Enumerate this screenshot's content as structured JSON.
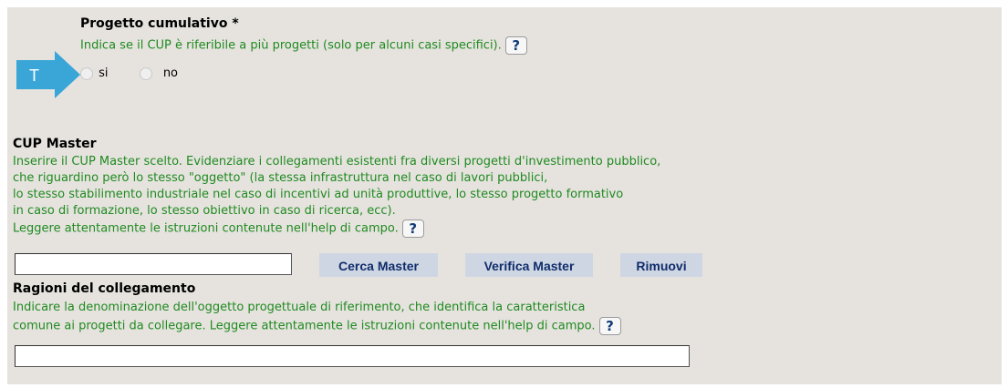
{
  "progetto": {
    "title": "Progetto cumulativo *",
    "description": "Indica se il CUP è riferibile a più progetti (solo per alcuni casi specifici).",
    "help_label": "?",
    "tag_label": "T",
    "options": [
      "si",
      "no"
    ]
  },
  "cup_master": {
    "title": "CUP Master",
    "lines": [
      "Inserire il CUP Master scelto. Evidenziare i collegamenti esistenti fra diversi progetti d'investimento pubblico,",
      "che riguardino però lo stesso \"oggetto\" (la stessa infrastruttura nel caso di lavori pubblici,",
      "lo stesso stabilimento industriale nel caso di incentivi ad unità produttive, lo stesso progetto formativo",
      "in caso di formazione, lo stesso obiettivo in caso di ricerca, ecc).",
      "Leggere attentamente le istruzioni contenute nell'help di campo."
    ],
    "help_label": "?",
    "input_value": "",
    "buttons": {
      "cerca": "Cerca Master",
      "verifica": "Verifica Master",
      "rimuovi": "Rimuovi"
    }
  },
  "ragioni": {
    "title": "Ragioni del collegamento",
    "lines": [
      "Indicare la denominazione dell'oggetto progettuale di riferimento, che identifica la caratteristica",
      "comune ai progetti da collegare. Leggere attentamente le istruzioni contenute nell'help di campo."
    ],
    "help_label": "?",
    "input_value": ""
  },
  "colors": {
    "panel_bg": "#e6e3df",
    "help_text": "#1f8a1f",
    "tag_arrow": "#3aa6d8",
    "button_bg": "#cfd6e3",
    "button_text": "#0f2d6b"
  }
}
